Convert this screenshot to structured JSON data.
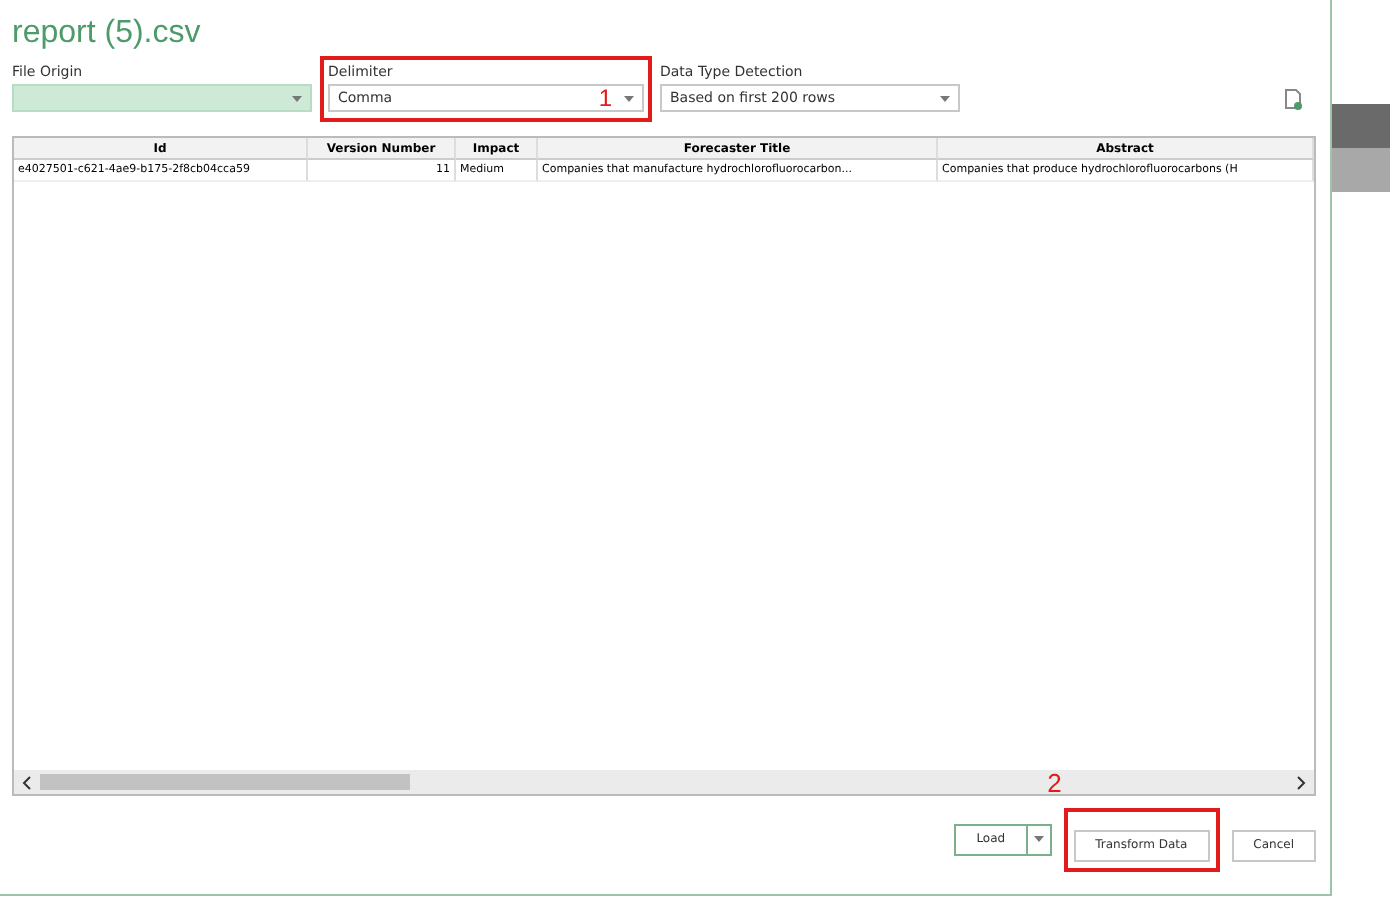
{
  "window": {
    "title": "report (5).csv"
  },
  "fields": [
    {
      "label": "File Origin",
      "highlighted": true,
      "annotated": false
    },
    {
      "label": "Delimiter",
      "value": "Comma",
      "highlighted": false,
      "annotated": true,
      "marker": "1"
    },
    {
      "label": "Data Type Detection",
      "value": "Based on first 200 rows",
      "highlighted": false,
      "annotated": false
    }
  ],
  "table": {
    "columns": [
      "Id",
      "Version Number",
      "Impact",
      "Forecaster Title",
      "Abstract"
    ],
    "rows": [
      [
        "e4027501-c621-4ae9-b175-2f8cb04cca59",
        "11",
        "Medium",
        "Companies that manufacture hydrochlorofluorocarbon...",
        "Companies that produce hydrochlorofluorocarbons (H"
      ]
    ]
  },
  "buttons": [
    {
      "label": "Load",
      "kind": "split",
      "annotated": false
    },
    {
      "label": "Transform Data",
      "kind": "plain",
      "annotated": true,
      "marker": "2"
    },
    {
      "label": "Cancel",
      "kind": "plain",
      "annotated": false
    }
  ]
}
